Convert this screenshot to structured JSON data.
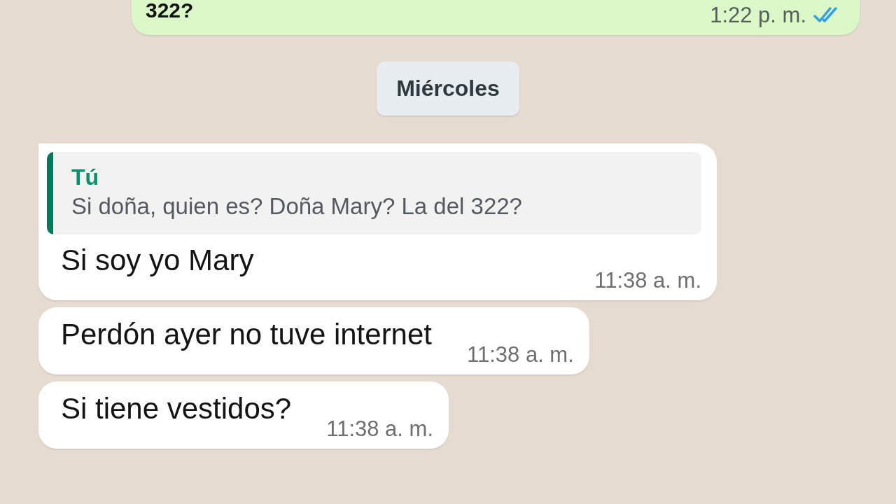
{
  "messages": [
    {
      "kind": "outgoing",
      "text": "322?",
      "time": "1:22 p. m.",
      "read": true
    },
    {
      "kind": "date",
      "text": "Miércoles"
    },
    {
      "kind": "incoming",
      "quote": {
        "author": "Tú",
        "text": "Si doña, quien es? Doña Mary? La del 322?"
      },
      "text": "Si soy yo Mary",
      "time": "11:38 a. m.",
      "tail": true
    },
    {
      "kind": "incoming",
      "text": "Perdón ayer no tuve internet",
      "time": "11:38 a. m.",
      "tail": false
    },
    {
      "kind": "incoming",
      "text": "Si tiene vestidos?",
      "time": "11:38 a. m.",
      "tail": false
    }
  ]
}
